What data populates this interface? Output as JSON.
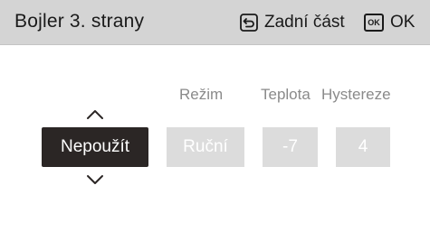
{
  "header": {
    "title": "Bojler 3. strany",
    "back_label": "Zadní část",
    "ok_icon_text": "OK",
    "ok_label": "OK",
    "back_icon": "return-arrow-icon",
    "ok_icon": "ok-key-icon"
  },
  "columns": {
    "mode_header": "Režim",
    "temp_header": "Teplota",
    "hyst_header": "Hystereze"
  },
  "fields": {
    "usage": "Nepoužít",
    "mode": "Ruční",
    "temperature": "-7",
    "hysteresis": "4"
  },
  "colors": {
    "header_bg": "#d4d4d4",
    "active_field_bg": "#2b2625",
    "inactive_field_bg": "#dcdcdc",
    "muted_text": "#8a8a8a"
  }
}
